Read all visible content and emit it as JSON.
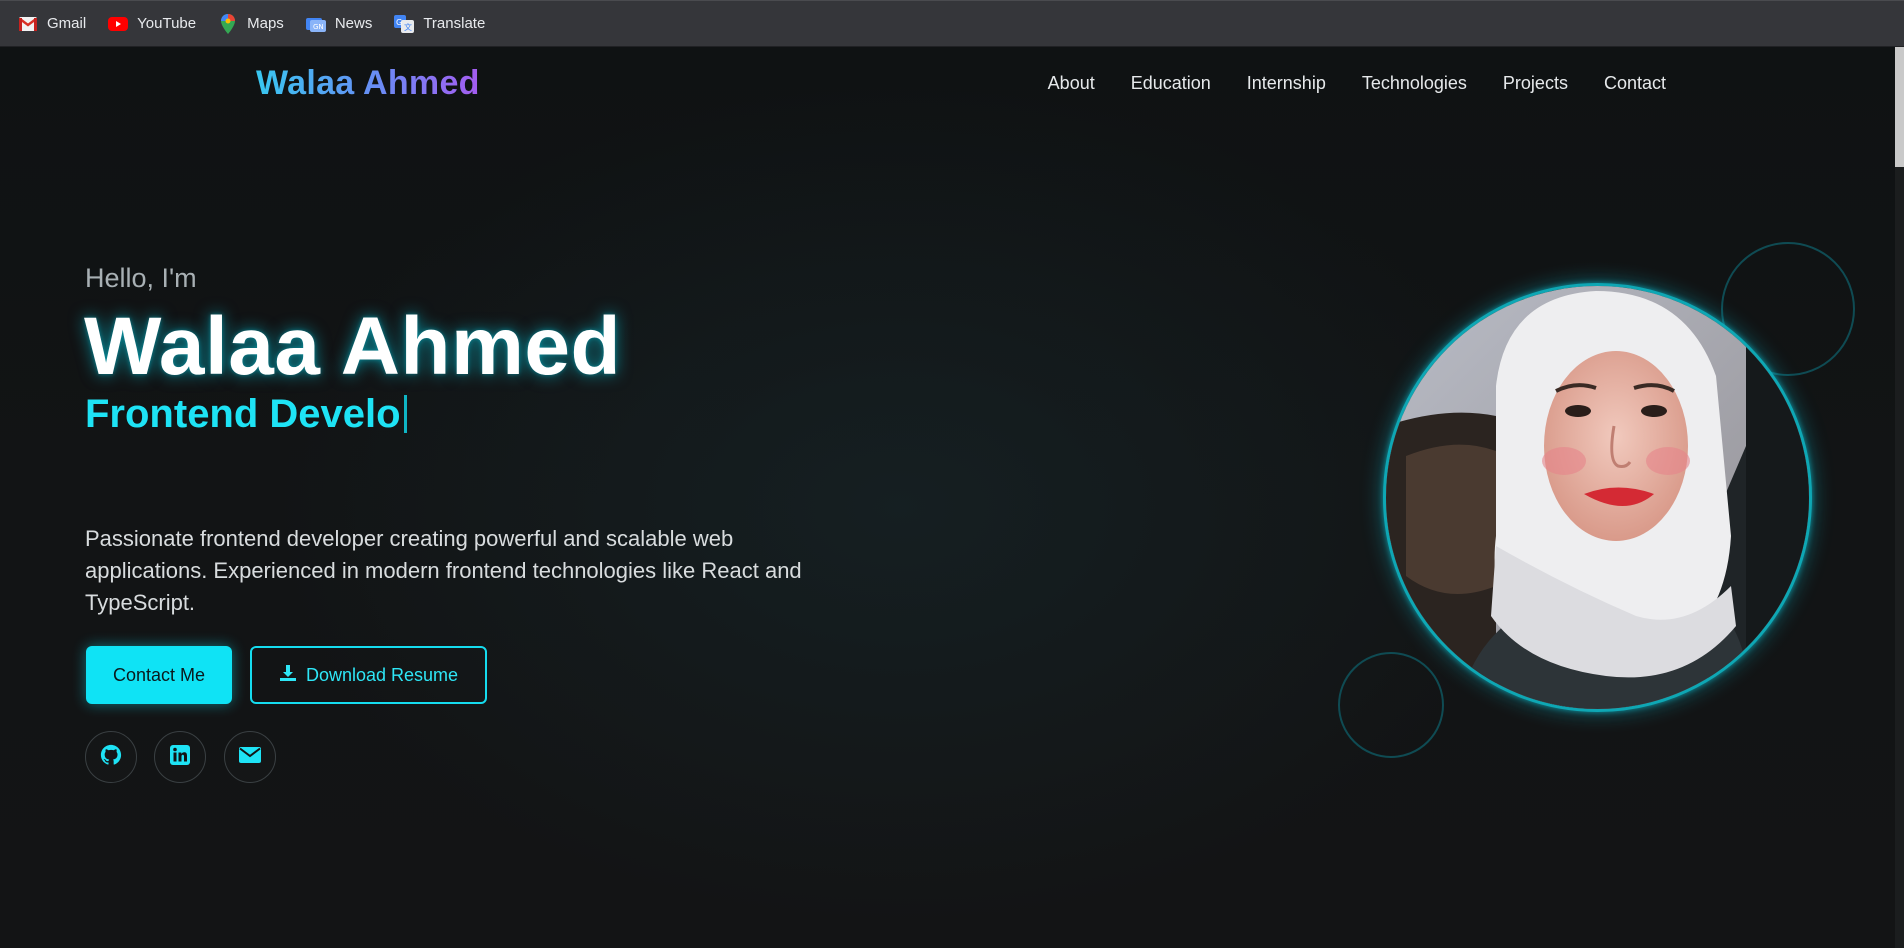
{
  "browser": {
    "bookmarks": [
      {
        "label": "Gmail",
        "icon": "gmail-icon"
      },
      {
        "label": "YouTube",
        "icon": "youtube-icon"
      },
      {
        "label": "Maps",
        "icon": "maps-icon"
      },
      {
        "label": "News",
        "icon": "news-icon"
      },
      {
        "label": "Translate",
        "icon": "translate-icon"
      }
    ]
  },
  "nav": {
    "logo": "Walaa Ahmed",
    "links": [
      "About",
      "Education",
      "Internship",
      "Technologies",
      "Projects",
      "Contact"
    ]
  },
  "hero": {
    "greeting": "Hello, I'm",
    "name": "Walaa Ahmed",
    "role_typed": "Frontend Develo",
    "description": "Passionate frontend developer creating powerful and scalable web applications. Experienced in modern frontend technologies like React and TypeScript.",
    "primary_button": "Contact Me",
    "secondary_button": "Download Resume",
    "socials": [
      {
        "icon": "github-icon"
      },
      {
        "icon": "linkedin-icon"
      },
      {
        "icon": "email-icon"
      }
    ]
  },
  "colors": {
    "accent": "#0fe3f5",
    "background": "#0e1011",
    "logo_gradient": [
      "#38c7f0",
      "#a55cf0"
    ]
  }
}
